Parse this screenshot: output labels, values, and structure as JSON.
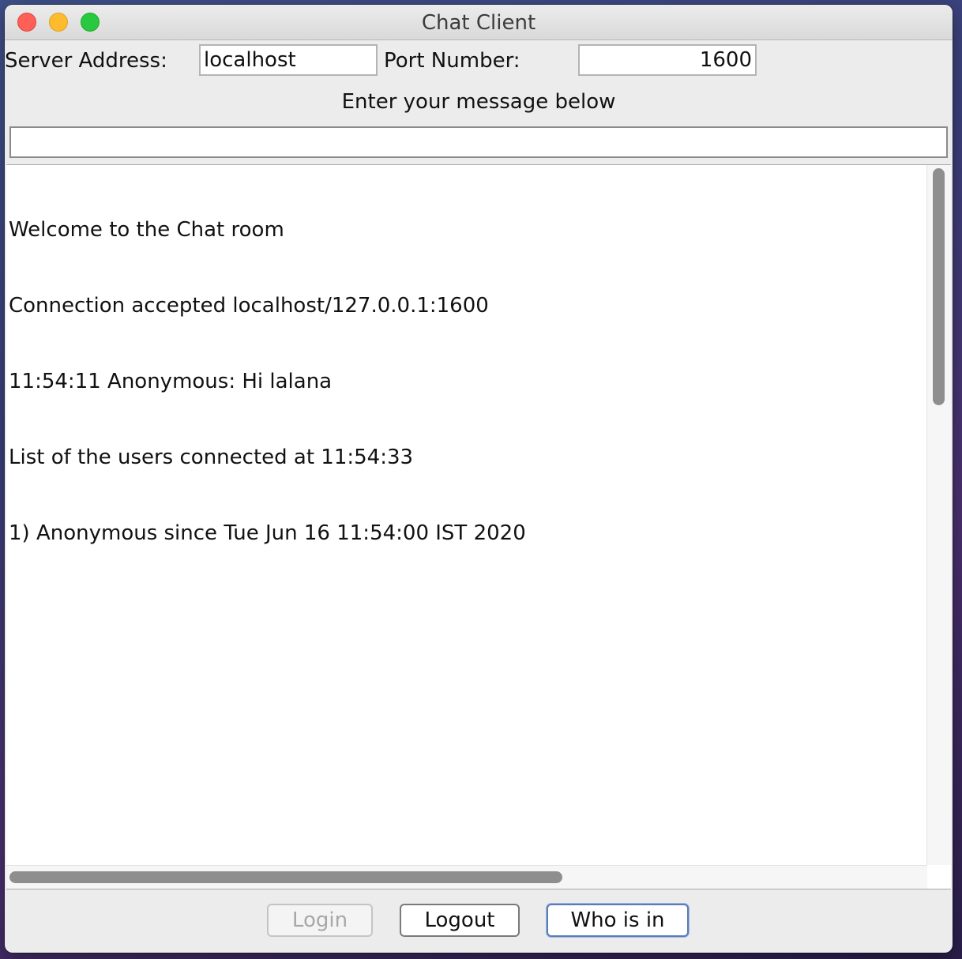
{
  "window": {
    "title": "Chat Client"
  },
  "connection": {
    "server_label": "Server Address:",
    "server_value": "localhost",
    "port_label": "Port Number:",
    "port_value": "1600"
  },
  "message": {
    "prompt": "Enter your message below",
    "value": ""
  },
  "chat": {
    "lines": [
      "Welcome to the Chat room",
      "Connection accepted localhost/127.0.0.1:1600",
      "11:54:11 Anonymous: Hi lalana",
      "List of the users connected at 11:54:33",
      "1) Anonymous since Tue Jun 16 11:54:00 IST 2020"
    ]
  },
  "buttons": {
    "login": "Login",
    "logout": "Logout",
    "whoisin": "Who is in"
  },
  "colors": {
    "close": "#fe5f57",
    "minimize": "#febb2e",
    "maximize": "#28c840"
  }
}
